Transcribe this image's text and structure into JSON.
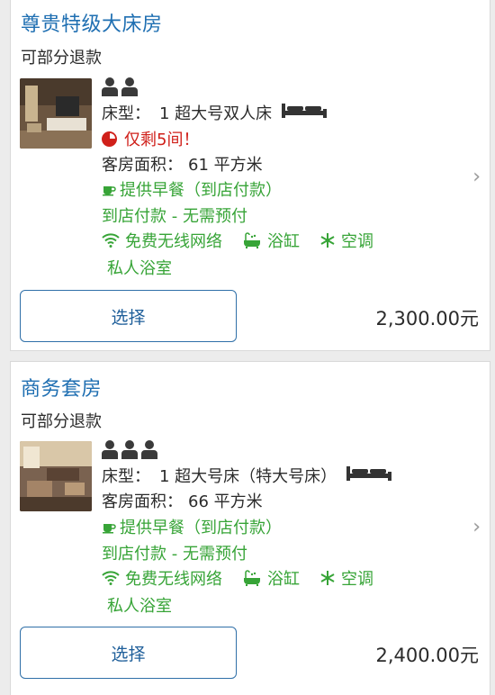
{
  "rooms": [
    {
      "title": "尊贵特级大床房",
      "refund": "可部分退款",
      "bed_prefix": "床型：",
      "bed": "1 超大号双人床",
      "availability": "仅剩5间！",
      "area_label": "客房面积：",
      "area": "61 平方米",
      "breakfast": "提供早餐（到店付款）",
      "payment": "到店付款 - 无需预付",
      "amenities": [
        "免费无线网络",
        "浴缸",
        "空调"
      ],
      "amenity_extra": "私人浴室",
      "select_label": "选择",
      "price": "2,300.00元"
    },
    {
      "title": "商务套房",
      "refund": "可部分退款",
      "bed_prefix": "床型：",
      "bed": "1 超大号床（特大号床）",
      "area_label": "客房面积：",
      "area": "66 平方米",
      "breakfast": "提供早餐（到店付款）",
      "payment": "到店付款 - 无需预付",
      "amenities": [
        "免费无线网络",
        "浴缸",
        "空调"
      ],
      "amenity_extra": "私人浴室",
      "select_label": "选择",
      "price": "2,400.00元"
    }
  ],
  "icons": {
    "occupancy": "person-icon",
    "bed": "double-bed-icon",
    "breakfast": "coffee-cup-icon",
    "wifi": "wifi-icon",
    "bathtub": "bathtub-icon",
    "ac": "snowflake-icon",
    "chevron": "chevron-right-icon",
    "chevron_glyph": "›"
  },
  "colors": {
    "title": "#1f6fb2",
    "green": "#37a437",
    "red": "#d0201a",
    "button_border": "#2f6fa8"
  }
}
